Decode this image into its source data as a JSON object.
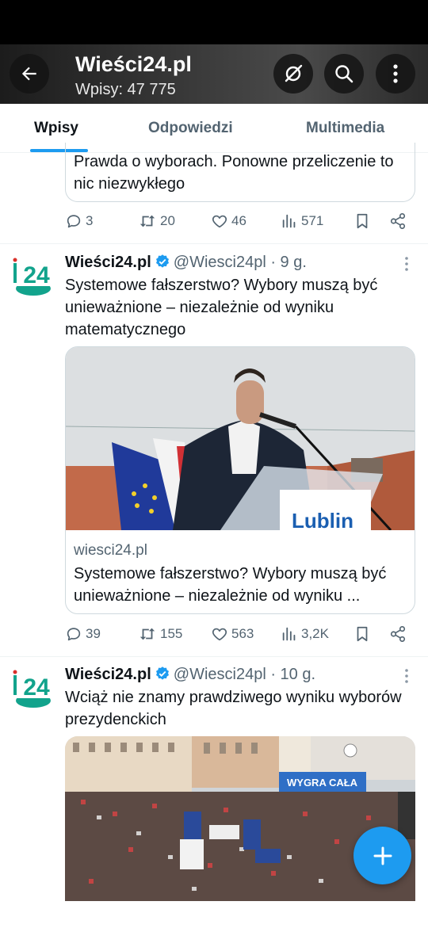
{
  "header": {
    "title": "Wieści24.pl",
    "post_count": "Wpisy: 47 775",
    "back_icon": "arrow-left-icon",
    "grok_icon": "slashed-circle-icon",
    "search_icon": "search-icon",
    "more_icon": "more-vertical-icon"
  },
  "tabs": [
    {
      "label": "Wpisy",
      "active": true
    },
    {
      "label": "Odpowiedzi",
      "active": false
    },
    {
      "label": "Multimedia",
      "active": false
    }
  ],
  "partial_tweet": {
    "card_text": "Prawda o wyborach. Ponowne przeliczenie to nic niezwykłego",
    "replies": "3",
    "reposts": "20",
    "likes": "46",
    "views": "571"
  },
  "tweets": [
    {
      "name": "Wieści24.pl",
      "handle": "@Wiesci24pl",
      "time": "· 9 g.",
      "text": "Systemowe fałszerstwo? Wybory muszą być unieważnione – niezależnie od wyniku matematycznego",
      "card_domain": "wiesci24.pl",
      "card_title": "Systemowe fałszerstwo? Wybory muszą być unieważnione – niezależnie od wyniku ...",
      "podium_sign": "Lublin",
      "replies": "39",
      "reposts": "155",
      "likes": "563",
      "views": "3,2K"
    },
    {
      "name": "Wieści24.pl",
      "handle": "@Wiesci24pl",
      "time": "· 10 g.",
      "text": "Wciąż nie znamy prawdziwego wyniku wyborów prezydenckich",
      "banner_text": "WYGRA CAŁA"
    }
  ],
  "avatar_text": "24",
  "colors": {
    "accent": "#1d9bf0",
    "avatar_teal": "#12a38c",
    "verified": "#1d9bf0"
  },
  "fab_icon": "plus-icon"
}
